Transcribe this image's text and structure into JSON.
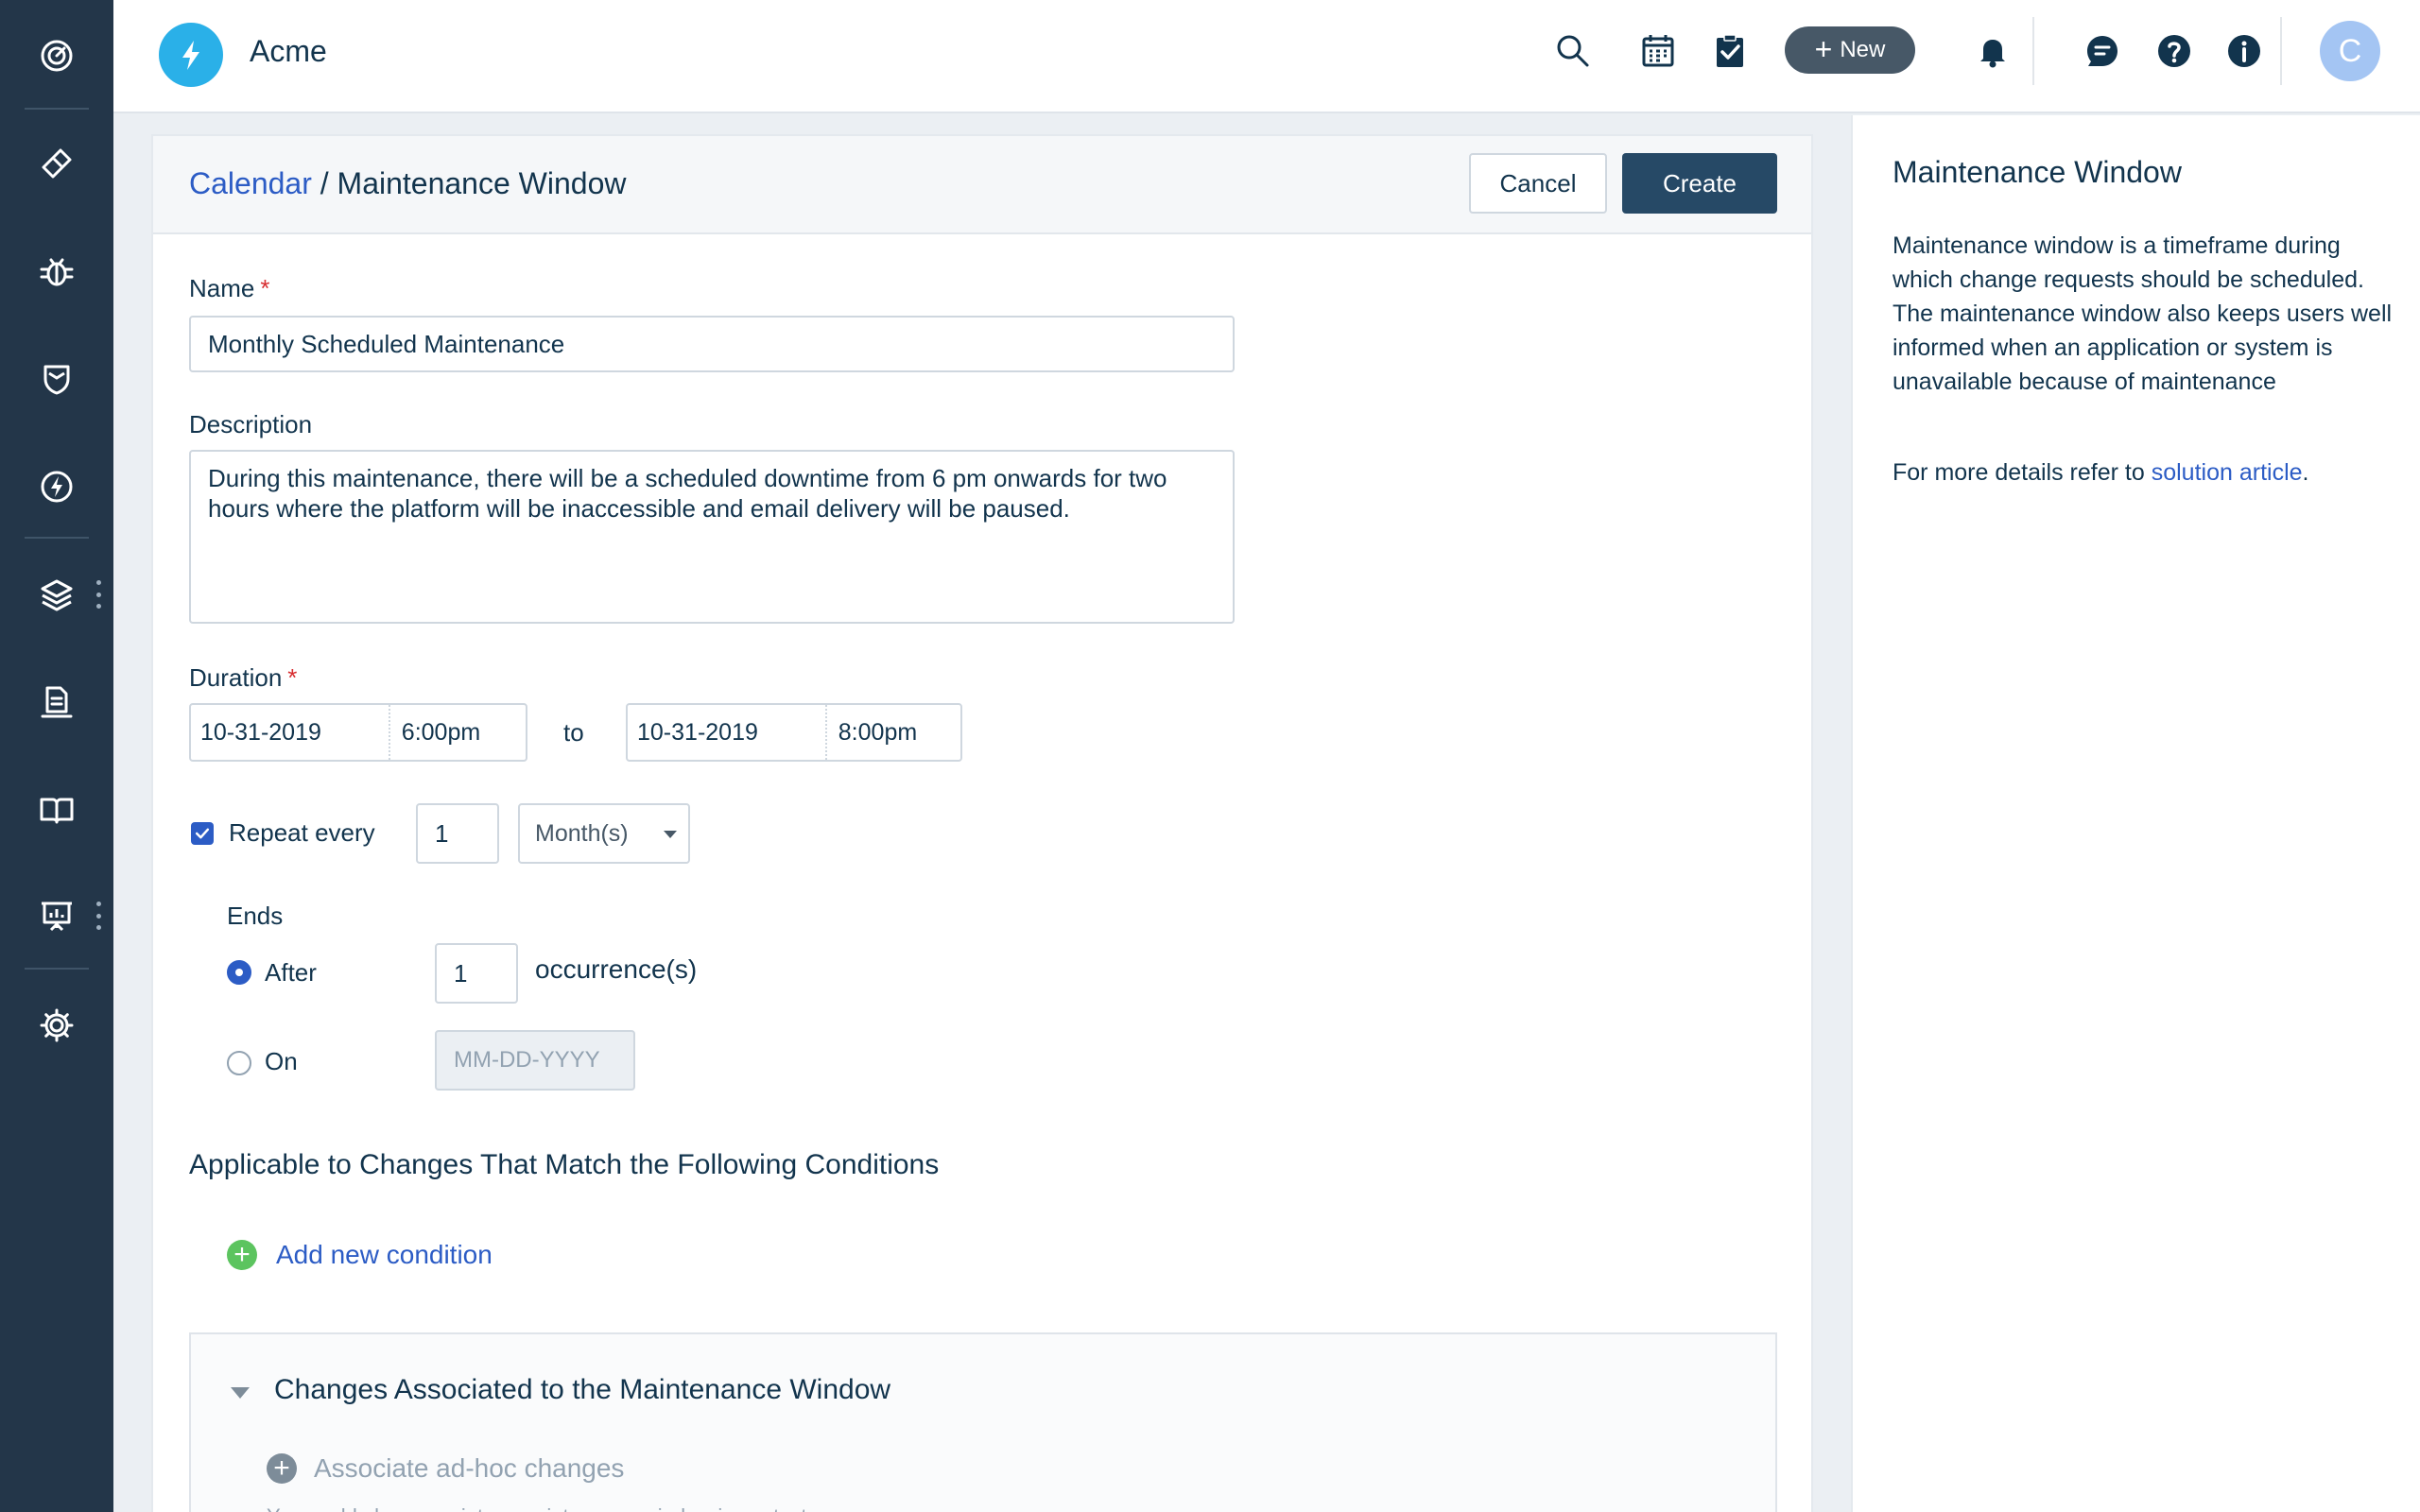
{
  "app": {
    "name": "Acme",
    "avatar_initial": "C"
  },
  "header": {
    "new_label": "New"
  },
  "sidebar": {
    "items": [
      {
        "icon": "dashboard-icon"
      },
      {
        "icon": "ticket-icon"
      },
      {
        "icon": "bug-icon"
      },
      {
        "icon": "shield-icon"
      },
      {
        "icon": "bolt-icon"
      },
      {
        "icon": "layers-icon"
      },
      {
        "icon": "assets-icon"
      },
      {
        "icon": "book-icon"
      },
      {
        "icon": "presentation-icon"
      },
      {
        "icon": "gear-icon"
      }
    ]
  },
  "breadcrumb": {
    "parent": "Calendar",
    "separator": " / ",
    "current": "Maintenance Window"
  },
  "actions": {
    "cancel": "Cancel",
    "create": "Create"
  },
  "form": {
    "name_label": "Name",
    "required_mark": "*",
    "name_value": "Monthly Scheduled Maintenance",
    "description_label": "Description",
    "description_value": "During this maintenance, there will be a scheduled downtime from 6 pm onwards for two hours where the platform will be inaccessible and email delivery will be paused.",
    "duration_label": "Duration",
    "start_date": "10-31-2019",
    "start_time": "6:00pm",
    "to_label": "to",
    "end_date": "10-31-2019",
    "end_time": "8:00pm",
    "repeat_label": "Repeat every",
    "repeat_checked": true,
    "repeat_value": "1",
    "repeat_unit": "Month(s)",
    "ends_label": "Ends",
    "after_label": "After",
    "after_value": "1",
    "occurrence_label": "occurrence(s)",
    "on_label": "On",
    "on_placeholder": "MM-DD-YYYY",
    "conditions_title": "Applicable to Changes That Match the Following Conditions",
    "add_condition": "Add new condition",
    "assoc_title": "Changes Associated to the Maintenance Window",
    "assoc_add": "Associate ad-hoc changes",
    "assoc_sub": "You could also associate a maintenance window in contact"
  },
  "panel": {
    "title": "Maintenance Window",
    "body": "Maintenance window is a timeframe during which change requests should be scheduled. The maintenance window also keeps users well informed when an application or system is unavailable because of maintenance",
    "more_prefix": "For more details refer to ",
    "more_link": "solution article",
    "more_suffix": "."
  },
  "colors": {
    "sidebar": "#233649",
    "accent": "#2c5cc5",
    "primary_button": "#264966",
    "logo": "#2ab0e8"
  }
}
